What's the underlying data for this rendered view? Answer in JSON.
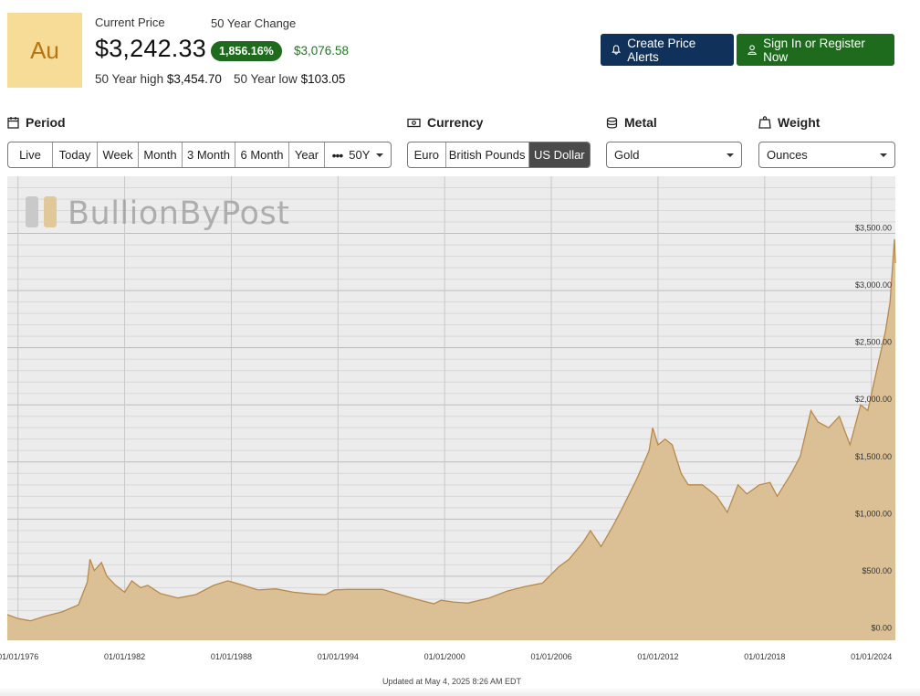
{
  "header": {
    "symbol": "Au",
    "current_price_label": "Current Price",
    "current_price": "$3,242.33",
    "change_label": "50 Year Change",
    "change_pct": "1,856.16%",
    "change_abs": "$3,076.58",
    "high_label": "50 Year high",
    "high_value": "$3,454.70",
    "low_label": "50 Year low",
    "low_value": "$103.05"
  },
  "actions": {
    "alert_label": "Create Price Alerts",
    "signin_label": "Sign In or Register Now",
    "alert_icon": "bell-icon",
    "signin_icon": "user-icon"
  },
  "period": {
    "title": "Period",
    "icon": "calendar-icon",
    "options": [
      "Live",
      "Today",
      "Week",
      "Month",
      "3 Month",
      "6 Month",
      "Year",
      "50Y"
    ],
    "selected": "50Y"
  },
  "currency": {
    "title": "Currency",
    "icon": "banknote-icon",
    "options": [
      "Euro",
      "British Pounds",
      "US Dollar"
    ],
    "selected": "US Dollar"
  },
  "metal": {
    "title": "Metal",
    "icon": "coins-icon",
    "selected": "Gold"
  },
  "weight": {
    "title": "Weight",
    "icon": "scale-icon",
    "selected": "Ounces"
  },
  "watermark": "BullionByPost",
  "updated_text": "Updated at May 4, 2025 8:26 AM EDT",
  "colors": {
    "area_fill": "#dcc095",
    "area_line": "#b8894a",
    "badge_green": "#1e6b1e",
    "alert_navy": "#10315a",
    "symbol_bg": "#f7dc98",
    "active_segment": "#4a4a4a"
  },
  "chart_data": {
    "type": "area",
    "x_ticks": [
      "01/01/1976",
      "01/01/1982",
      "01/01/1988",
      "01/01/1994",
      "01/01/2000",
      "01/01/2006",
      "01/01/2012",
      "01/01/2018",
      "01/01/2024"
    ],
    "y_ticks": [
      "$0.00",
      "$500.00",
      "$1,000.00",
      "$1,500.00",
      "$2,000.00",
      "$2,500.00",
      "$3,000.00",
      "$3,500.00"
    ],
    "xlim": [
      1975.4,
      2025.35
    ],
    "ylim": [
      -60,
      4000
    ],
    "grid": true,
    "series": [
      {
        "x": [
          1975.4,
          1976.0,
          1976.7,
          1977.5,
          1978.5,
          1979.4,
          1979.9,
          1980.05,
          1980.3,
          1980.7,
          1981.0,
          1981.5,
          1982.0,
          1982.4,
          1982.9,
          1983.3,
          1984.0,
          1985.0,
          1986.0,
          1987.0,
          1987.8,
          1988.5,
          1989.5,
          1990.5,
          1991.5,
          1992.5,
          1993.3,
          1993.8,
          1994.5,
          1995.5,
          1996.5,
          1997.5,
          1998.5,
          1999.4,
          1999.8,
          2000.5,
          2001.3,
          2002.5,
          2003.5,
          2004.5,
          2005.5,
          2006.4,
          2007.0,
          2007.8,
          2008.2,
          2008.8,
          2009.5,
          2010.0,
          2010.8,
          2011.5,
          2011.7,
          2012.0,
          2012.4,
          2012.8,
          2013.3,
          2013.7,
          2014.5,
          2015.3,
          2015.9,
          2016.5,
          2017.0,
          2017.7,
          2018.3,
          2018.7,
          2019.5,
          2020.0,
          2020.6,
          2021.0,
          2021.6,
          2022.2,
          2022.8,
          2023.4,
          2023.8,
          2024.3,
          2024.8,
          2025.05,
          2025.3,
          2025.35
        ],
        "y": [
          165,
          130,
          110,
          150,
          190,
          250,
          450,
          650,
          550,
          620,
          500,
          420,
          360,
          460,
          400,
          420,
          350,
          310,
          340,
          420,
          460,
          430,
          380,
          390,
          360,
          345,
          340,
          380,
          385,
          385,
          385,
          340,
          295,
          260,
          290,
          275,
          265,
          310,
          370,
          410,
          440,
          580,
          650,
          800,
          900,
          760,
          950,
          1100,
          1350,
          1600,
          1800,
          1650,
          1700,
          1650,
          1400,
          1300,
          1300,
          1200,
          1060,
          1300,
          1220,
          1300,
          1320,
          1200,
          1400,
          1550,
          1950,
          1850,
          1800,
          1900,
          1650,
          2000,
          1950,
          2300,
          2650,
          2900,
          3450,
          3240
        ]
      }
    ]
  }
}
